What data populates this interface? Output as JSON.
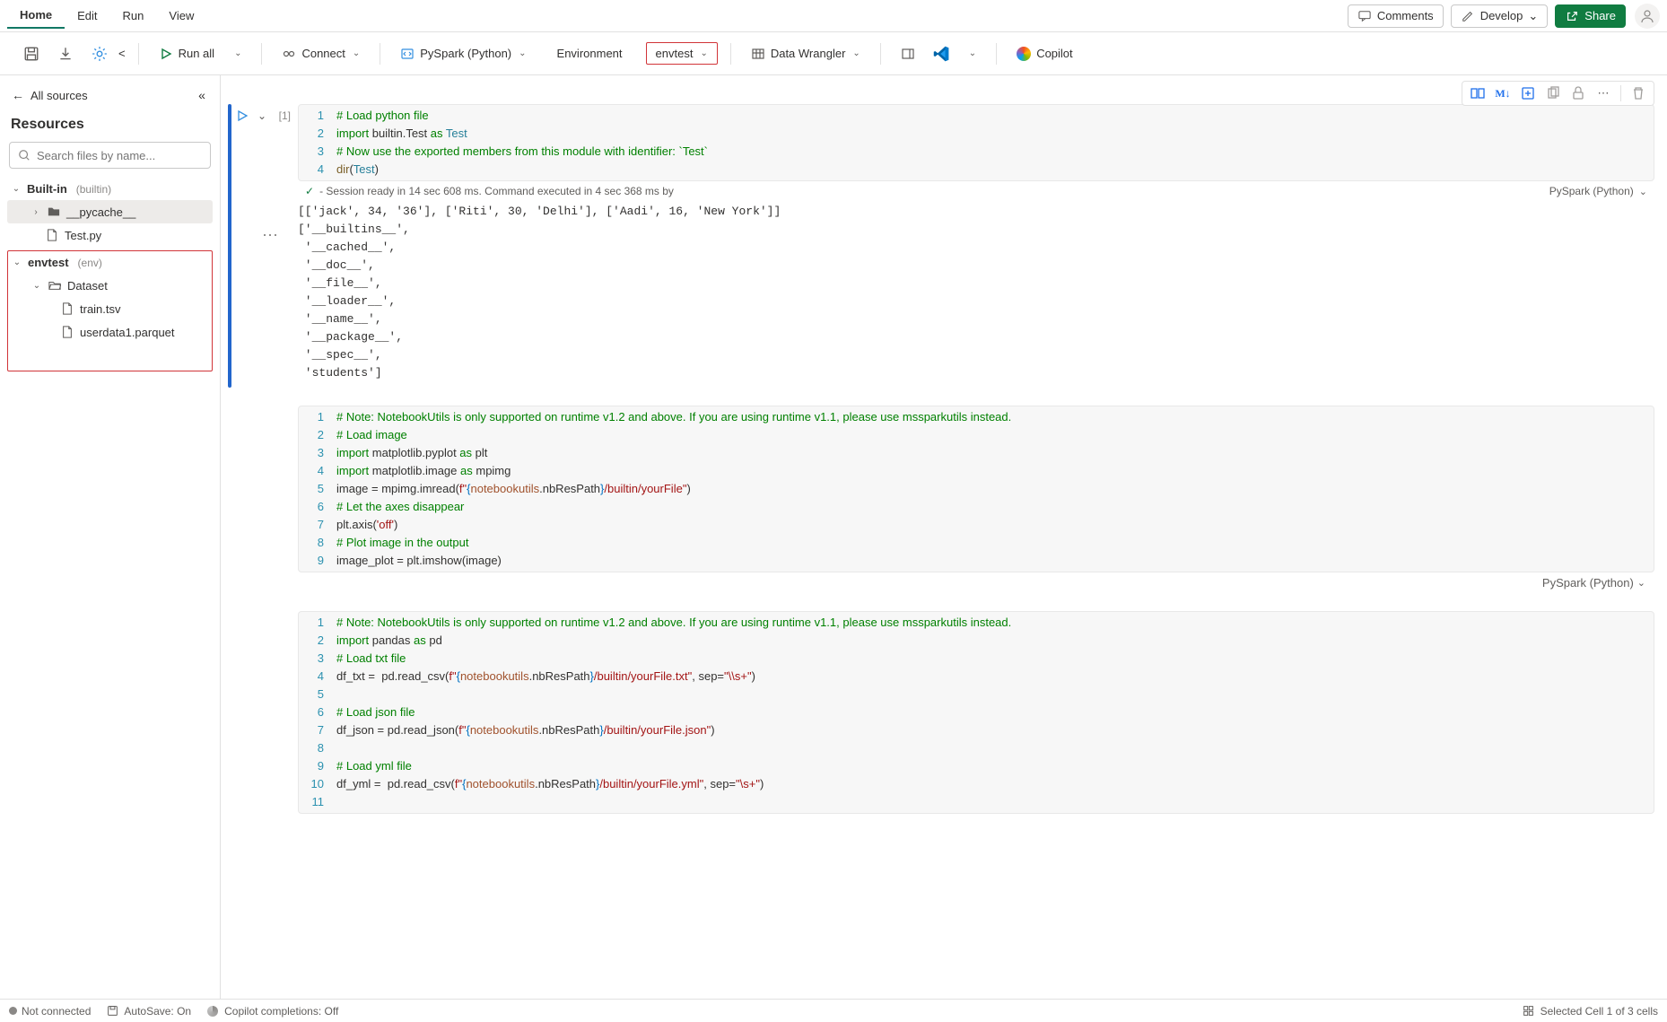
{
  "menubar": {
    "tabs": [
      "Home",
      "Edit",
      "Run",
      "View"
    ],
    "comments": "Comments",
    "develop": "Develop",
    "share": "Share"
  },
  "toolbar": {
    "run_all": "Run all",
    "connect": "Connect",
    "pyspark": "PySpark (Python)",
    "environment": "Environment",
    "envtest": "envtest",
    "data_wrangler": "Data Wrangler",
    "copilot": "Copilot"
  },
  "sidebar": {
    "back": "All sources",
    "title": "Resources",
    "search_placeholder": "Search files by name...",
    "builtin_label": "Built-in",
    "builtin_hint": "(builtin)",
    "pycache": "__pycache__",
    "testpy": "Test.py",
    "envtest_label": "envtest",
    "envtest_hint": "(env)",
    "dataset": "Dataset",
    "train": "train.tsv",
    "userdata": "userdata1.parquet"
  },
  "cell1": {
    "prompt": "[1]",
    "status": "- Session ready in 14 sec 608 ms. Command executed in 4 sec 368 ms by",
    "kernel": "PySpark (Python)",
    "code": {
      "l1a": "# Load python file",
      "l2_import": "import",
      "l2_mod": " builtin.Test ",
      "l2_as": "as",
      "l2_alias": " Test",
      "l3a": "# Now use the exported members from this module with identifier: `Test`",
      "l4_dir": "dir",
      "l4_p1": "(",
      "l4_test": "Test",
      "l4_p2": ")"
    },
    "output": "[['jack', 34, '36'], ['Riti', 30, 'Delhi'], ['Aadi', 16, 'New York']]\n['__builtins__',\n '__cached__',\n '__doc__',\n '__file__',\n '__loader__',\n '__name__',\n '__package__',\n '__spec__',\n 'students']"
  },
  "cell2": {
    "kernel": "PySpark (Python)",
    "l1": "# Note: NotebookUtils is only supported on runtime v1.2 and above. If you are using runtime v1.1, please use mssparkutils instead.",
    "l2": "# Load image",
    "l3_import": "import",
    "l3_mod": " matplotlib.pyplot ",
    "l3_as": "as",
    "l3_alias": " plt",
    "l4_import": "import",
    "l4_mod": " matplotlib.image ",
    "l4_as": "as",
    "l4_alias": " mpimg",
    "l5_pre": "image = mpimg.imread(",
    "l5_f": "f\"",
    "l5_b1": "{",
    "l5_nb": "notebookutils",
    "l5_nbres": ".nbResPath",
    "l5_b2": "}",
    "l5_tail": "/builtin/yourFile\"",
    "l5_close": ")",
    "l6": "# Let the axes disappear",
    "l7_pre": "plt.axis(",
    "l7_str": "'off'",
    "l7_close": ")",
    "l8": "# Plot image in the output",
    "l9": "image_plot = plt.imshow(image)"
  },
  "cell3": {
    "l1": "# Note: NotebookUtils is only supported on runtime v1.2 and above. If you are using runtime v1.1, please use mssparkutils instead.",
    "l2_import": "import",
    "l2_mod": " pandas ",
    "l2_as": "as",
    "l2_alias": " pd",
    "l3": "# Load txt file",
    "l4_pre": "df_txt =  pd.read_csv(",
    "l4_f": "f\"",
    "l4_b1": "{",
    "l4_nb": "notebookutils",
    "l4_nbres": ".nbResPath",
    "l4_b2": "}",
    "l4_path": "/builtin/yourFile.txt\"",
    "l4_sep": ", sep=",
    "l4_sepv": "\"\\\\s+\"",
    "l4_close": ")",
    "l6": "# Load json file",
    "l7_pre": "df_json = pd.read_json(",
    "l7_f": "f\"",
    "l7_b1": "{",
    "l7_nb": "notebookutils",
    "l7_nbres": ".nbResPath",
    "l7_b2": "}",
    "l7_path": "/builtin/yourFile.json\"",
    "l7_close": ")",
    "l9": "# Load yml file",
    "l10_pre": "df_yml =  pd.read_csv(",
    "l10_f": "f\"",
    "l10_b1": "{",
    "l10_nb": "notebookutils",
    "l10_nbres": ".nbResPath",
    "l10_b2": "}",
    "l10_path": "/builtin/yourFile.yml\"",
    "l10_sep": ", sep=",
    "l10_sepv": "\"\\s+\"",
    "l10_close": ")"
  },
  "statusbar": {
    "not_connected": "Not connected",
    "autosave": "AutoSave: On",
    "copilot": "Copilot completions: Off",
    "selected": "Selected Cell 1 of 3 cells"
  }
}
